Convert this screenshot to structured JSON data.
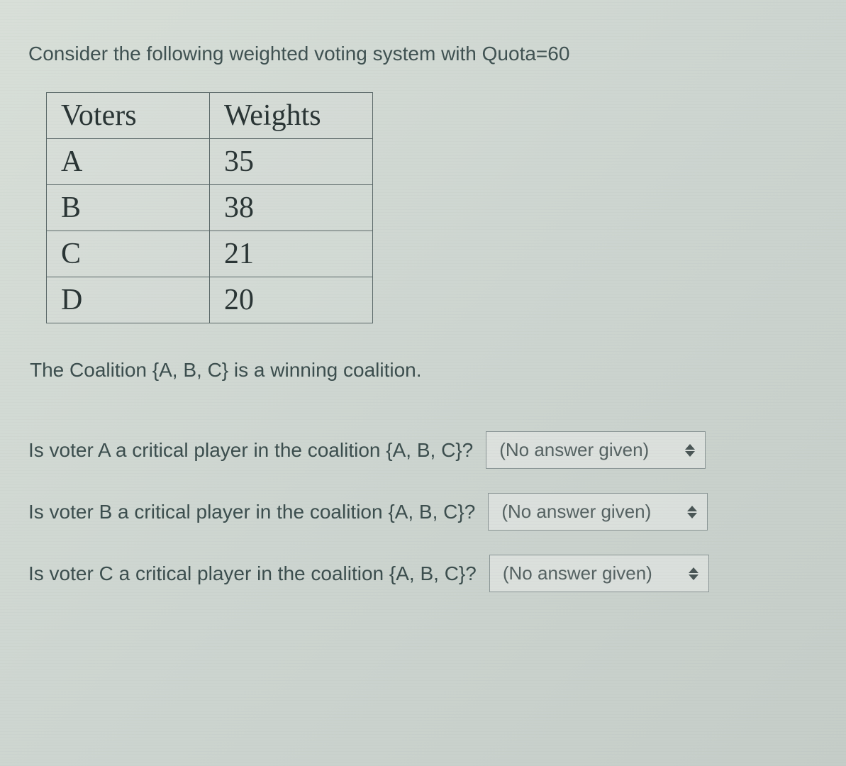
{
  "intro": "Consider the following weighted voting system with Quota=60",
  "table": {
    "headers": {
      "voters": "Voters",
      "weights": "Weights"
    },
    "rows": [
      {
        "voter": "A",
        "weight": "35"
      },
      {
        "voter": "B",
        "weight": "38"
      },
      {
        "voter": "C",
        "weight": "21"
      },
      {
        "voter": "D",
        "weight": "20"
      }
    ]
  },
  "statement": "The Coalition {A, B, C} is a winning coalition.",
  "questions": [
    {
      "text": "Is voter A a critical player in the coalition {A, B, C}?",
      "selected": "(No answer given)"
    },
    {
      "text": "Is voter B a critical player in the coalition {A, B, C}?",
      "selected": "(No answer given)"
    },
    {
      "text": "Is voter C a critical player in the coalition {A, B, C}?",
      "selected": "(No answer given)"
    }
  ]
}
